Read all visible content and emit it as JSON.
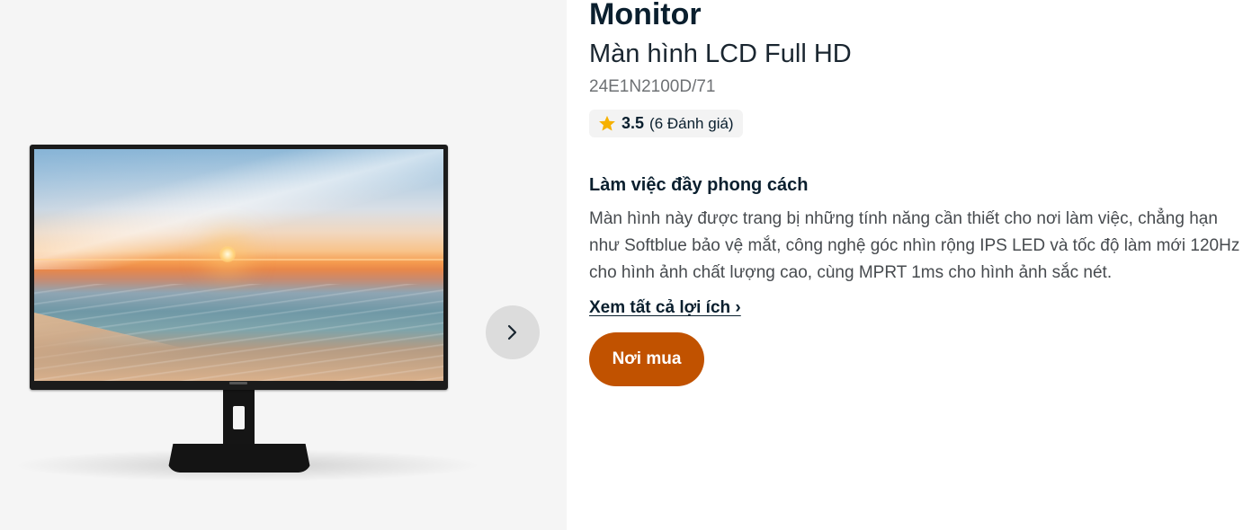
{
  "product": {
    "category": "Monitor",
    "name": "Màn hình LCD Full HD",
    "model": "24E1N2100D/71",
    "rating": {
      "score": "3.5",
      "count_text": "(6 Đánh giá)",
      "star_color": "#f6b100"
    }
  },
  "gallery": {
    "image_icon": "monitor-product-image",
    "next_icon": "chevron-right-icon"
  },
  "feature": {
    "heading": "Làm việc đầy phong cách",
    "description": "Màn hình này được trang bị những tính năng cần thiết cho nơi làm việc, chẳng hạn như Softblue bảo vệ mắt, công nghệ góc nhìn rộng IPS LED và tốc độ làm mới 120Hz cho hình ảnh chất lượng cao, cùng MPRT 1ms cho hình ảnh sắc nét.",
    "benefits_link": "Xem tất cả lợi ích ›"
  },
  "actions": {
    "buy_label": "Nơi mua"
  },
  "colors": {
    "gallery_bg": "#f5f5f5",
    "text_primary": "#0a1f2e",
    "buy_button": "#c15200",
    "carousel_button": "#dcdcdc"
  }
}
